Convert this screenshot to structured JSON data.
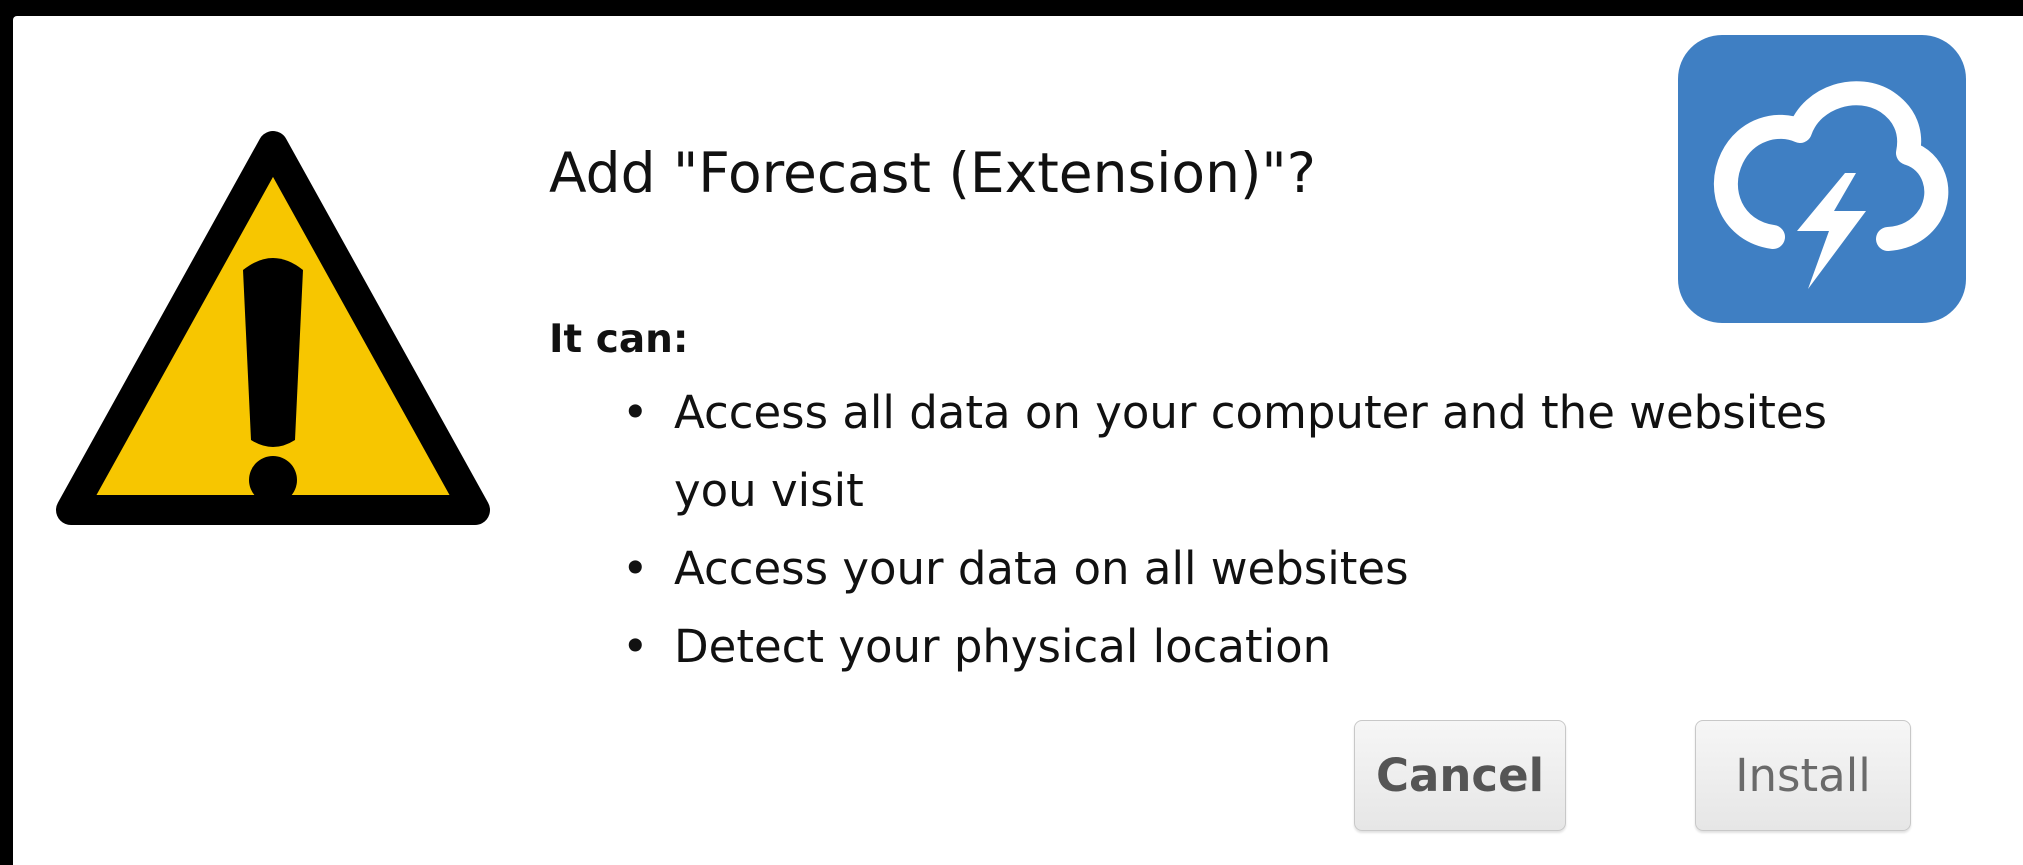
{
  "dialog": {
    "title": "Add \"Forecast (Extension)\"?",
    "subtitle": "It can:",
    "permissions": [
      {
        "bullet": "•",
        "text": "Access all data on your computer and the websites you visit"
      },
      {
        "bullet": "•",
        "text": "Access your data on all websites"
      },
      {
        "bullet": "•",
        "text": "Detect your physical location"
      }
    ],
    "buttons": {
      "cancel_label": "Cancel",
      "install_label": "Install"
    }
  },
  "icons": {
    "warning": "warning-triangle-icon",
    "app": "forecast-cloud-lightning-icon"
  },
  "colors": {
    "warning_yellow": "#f7c600",
    "app_icon_blue": "#3f7fc3",
    "text": "#111111"
  }
}
